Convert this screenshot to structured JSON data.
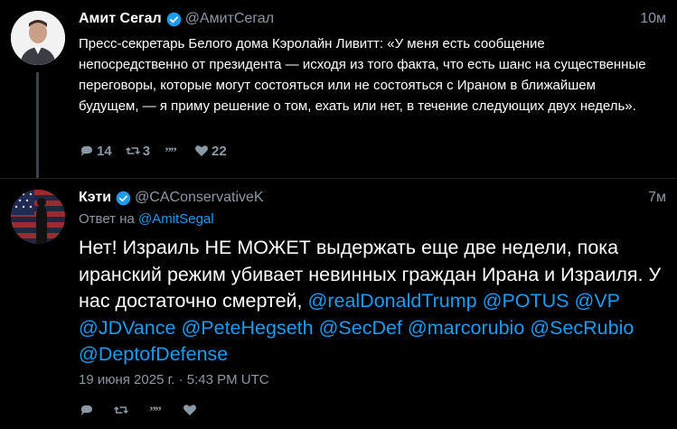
{
  "tweet1": {
    "name": "Амит Сегал",
    "handle": "@АмитСегал",
    "time": "10м",
    "text": "Пресс-секретарь Белого дома Кэролайн Ливитт: «У меня есть сообщение непосредственно от президента — исходя из того факта, что есть шанс на существенные переговоры, которые могут состояться или не состояться с Ираном в ближайшем будущем, — я приму решение о том, ехать или нет, в течение следующих двух недель».",
    "replies": "14",
    "retweets": "3",
    "likes": "22"
  },
  "tweet2": {
    "name": "Кэти",
    "handle": "@CAConservativeK",
    "time": "7м",
    "reply_prefix": "Ответ на",
    "reply_to": "@AmitSegal",
    "text_plain": "Нет! Израиль НЕ МОЖЕТ выдержать еще две недели, пока иранский режим убивает невинных граждан Ирана и Израиля. У нас достаточно смертей,",
    "mentions": [
      "@realDonaldTrump",
      "@POTUS",
      "@VP",
      "@JDVance",
      "@PeteHegseth",
      "@SecDef",
      "@marcorubio",
      "@SecRubio",
      "@DeptofDefense"
    ],
    "date": "19 июня 2025 г. · 5:43 PM UTC"
  },
  "colors": {
    "background": "#000000",
    "text": "#ffffff",
    "muted": "#8b98a5",
    "link": "#1d9bf0",
    "thread_line": "#39424b"
  },
  "icons": [
    "verified-icon",
    "reply-icon",
    "retweet-icon",
    "quote-icon",
    "like-icon"
  ]
}
